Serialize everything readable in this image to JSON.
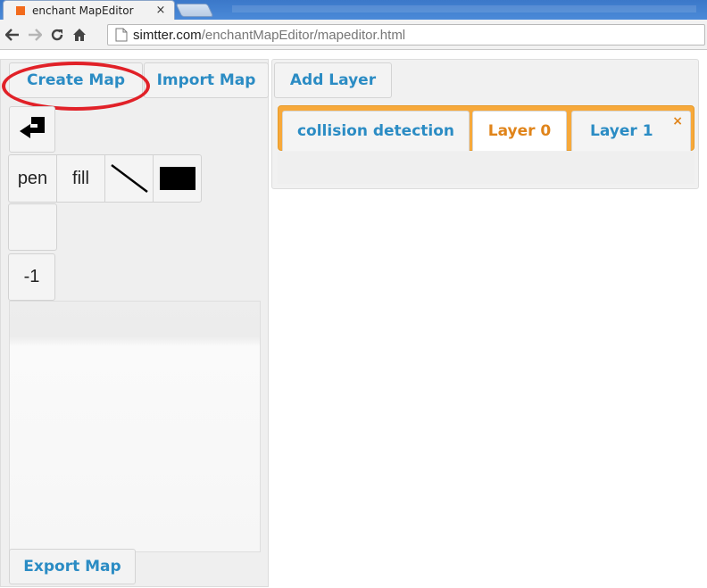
{
  "browser": {
    "tab_title": "enchant MapEditor",
    "tab_close": "×",
    "url_host": "simtter.com",
    "url_path": "/enchantMapEditor/mapeditor.html"
  },
  "left_panel": {
    "create_map": "Create Map",
    "import_map": "Import Map",
    "export_map": "Export Map",
    "tools": {
      "pen": "pen",
      "fill": "fill",
      "index": "-1"
    }
  },
  "right_panel": {
    "add_layer": "Add Layer",
    "layer_tabs": [
      {
        "label": "collision detection",
        "active": false
      },
      {
        "label": "Layer 0",
        "active": true
      },
      {
        "label": "Layer 1",
        "active": false
      }
    ],
    "layer_close": "×"
  },
  "colors": {
    "accent_blue": "#2b8cc4",
    "tab_orange": "#f7a93b",
    "active_orange_text": "#e0841a",
    "annotation_red": "#e12128"
  },
  "icons": [
    "back-arrow-icon",
    "forward-arrow-icon",
    "reload-icon",
    "home-icon",
    "page-icon",
    "undo-arrow-icon",
    "line-tool-icon",
    "rect-tool-icon"
  ]
}
